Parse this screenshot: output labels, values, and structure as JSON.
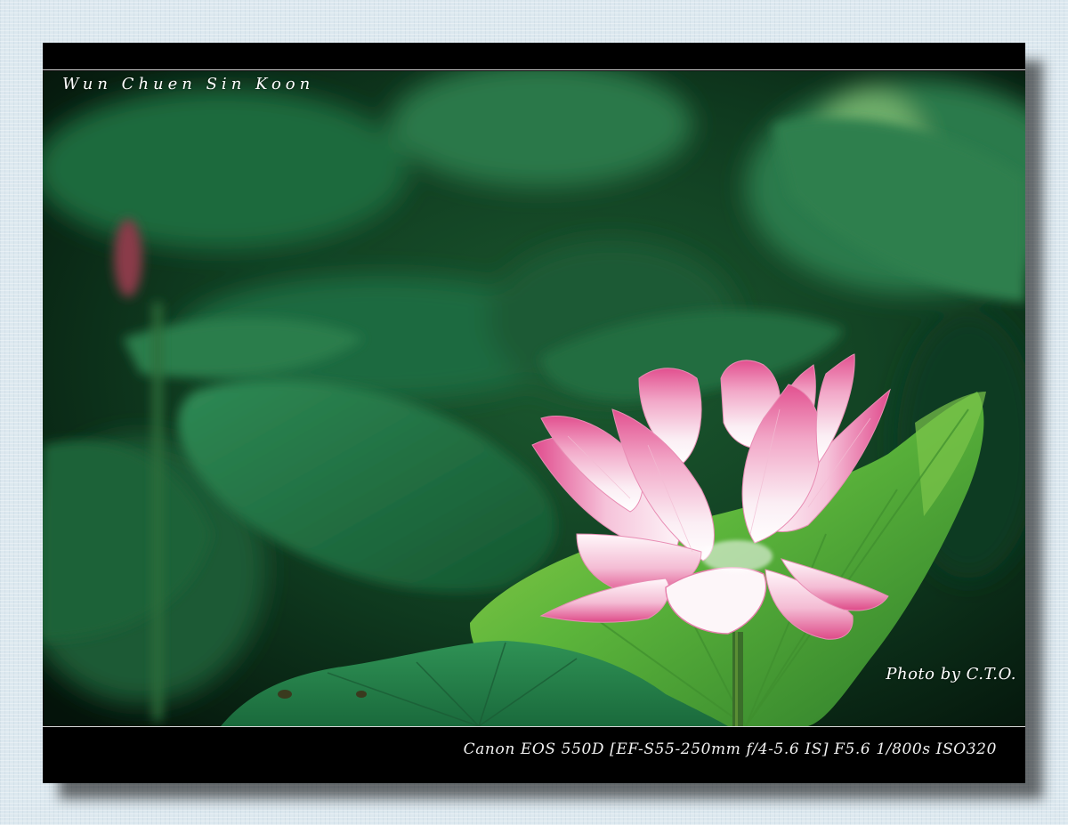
{
  "photo": {
    "photographer_name": "Wun Chuen Sin Koon",
    "credit": "Photo by C.T.O.",
    "exif_caption": "Canon EOS 550D [EF-S55-250mm f/4-5.6 IS] F5.6 1/800s ISO320",
    "subject": "pink lotus flower among green lotus leaves"
  },
  "colors": {
    "frame": "#000000",
    "frame_rule": "#d8d8d8",
    "page_background": "#dce8ef",
    "petal_pink": "#e04a8c",
    "petal_white": "#fbf3f6",
    "leaf_green": "#2f8f4a",
    "leaf_bright": "#5fb83c"
  }
}
